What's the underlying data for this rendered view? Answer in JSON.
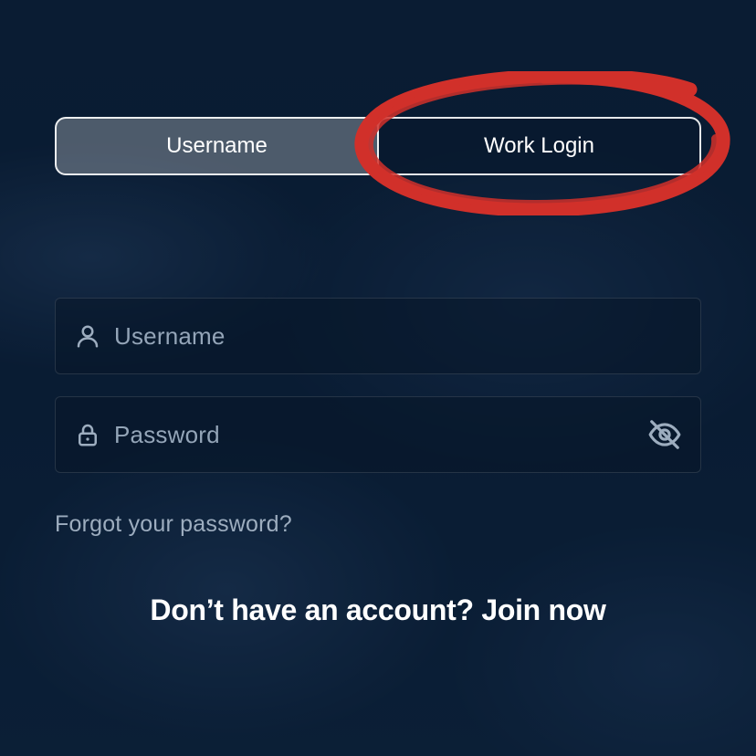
{
  "tabs": {
    "username": "Username",
    "work_login": "Work Login",
    "active": "username"
  },
  "fields": {
    "username": {
      "value": "",
      "placeholder": "Username"
    },
    "password": {
      "value": "",
      "placeholder": "Password"
    }
  },
  "links": {
    "forgot_password": "Forgot your password?",
    "join_now": "Don’t have an account? Join now"
  },
  "annotation": {
    "shape": "red-ellipse",
    "target": "work-login-tab",
    "color": "#d1302a"
  }
}
